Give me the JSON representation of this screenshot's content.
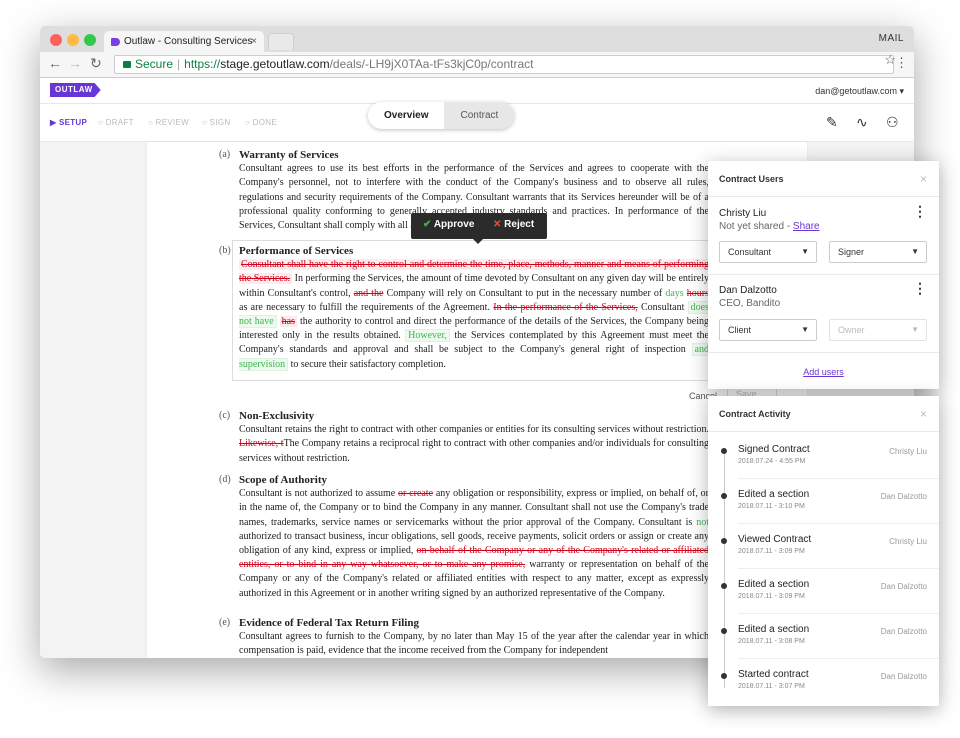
{
  "browser": {
    "tab_title": "Outlaw - Consulting Services",
    "tab_close": "×",
    "mail_label": "MAIL",
    "secure_label": "Secure",
    "url_scheme": "https://",
    "url_host": "stage.getoutlaw.com",
    "url_path": "/deals/-LH9jX0TAa-tFs3kjC0p/contract"
  },
  "app": {
    "logo": "OUTLAW",
    "user_email": "dan@getoutlaw.com ▾",
    "steps": [
      "▶ SETUP",
      "○ DRAFT",
      "○ REVIEW",
      "○ SIGN",
      "○ DONE"
    ],
    "view_tabs": [
      "Overview",
      "Contract"
    ]
  },
  "popover": {
    "approve": "Approve",
    "reject": "Reject",
    "approve_icon": "✔",
    "reject_icon": "✕"
  },
  "document": {
    "a": {
      "letter": "(a)",
      "title": "Warranty of Services",
      "body": "Consultant agrees to use its best efforts in the performance of the Services and agrees to cooperate with the Company's personnel, not to interfere with the conduct of the Company's business and to observe all rules, regulations and security requirements of the Company. Consultant warrants that its Services hereunder will be of a professional quality conforming to generally accepted industry standards and practices. In performance of the Services, Consultant shall comply with all applicable law."
    },
    "b": {
      "letter": "(b)",
      "title": "Performance of Services",
      "del1": "Consultant shall have the right to control and determine the time, place, methods, manner and means of performing the Services.",
      "t1": " In performing the Services, the amount of time devoted by Consultant on any given day will be entirely within Consultant's control, ",
      "del2": "and the",
      "t2": " Company will rely on Consultant to put in the necessary number of ",
      "ins1": "days",
      "del3": "hours",
      "t3": " as are necessary to fulfill the requirements of the Agreement. ",
      "del4": "In the performance of the Services,",
      "t4": " Consultant ",
      "ins2": "does not have",
      "del5": "has",
      "t5": " the authority to control and direct the performance of the details of the Services, the Company being interested only in the results obtained. ",
      "ins3": "However,",
      "t6": " the Services contemplated by this Agreement must meet the Company's standards and approval and shall be subject to the Company's general right of inspection ",
      "ins4": "and supervision",
      "t7": " to secure their satisfactory completion."
    },
    "cancel": "Cancel",
    "save": "Save",
    "c": {
      "letter": "(c)",
      "title": "Non-Exclusivity",
      "t1": "Consultant retains the right to contract with other companies or entities for its consulting services without restriction. ",
      "del1": "Likewise, t",
      "t2": "The Company retains a reciprocal right to contract with other companies and/or individuals for consulting services without restriction."
    },
    "d": {
      "letter": "(d)",
      "title": "Scope of Authority",
      "t1": "Consultant is not authorized to assume ",
      "del1": "or create",
      "t2": " any obligation or responsibility, express or implied, on behalf of, or in the name of, the Company or to bind the Company in any manner. Consultant shall not use the Company's trade names, trademarks, service names or servicemarks without the prior approval of the Company. Consultant is ",
      "ins1": "not",
      "t3": " authorized to transact business, incur obligations, sell goods, receive payments, solicit orders or assign or create any obligation of any kind, express or implied, ",
      "del2": "on behalf of the Company or any of the Company's related or affiliated entities, or to bind in any way whatsoever, or to make any promise,",
      "t4": " warranty or representation on behalf of the Company or any of the Company's related or affiliated entities with respect to any matter, except as expressly authorized in this Agreement or in another writing signed by an authorized representative of the Company."
    },
    "e": {
      "letter": "(e)",
      "title": "Evidence of Federal Tax Return Filing",
      "body": "Consultant agrees to furnish to the Company, by no later than May 15 of the year after the calendar year in which compensation is paid, evidence that the income received from the Company for independent"
    }
  },
  "contract_users": {
    "title": "Contract Users",
    "close": "×",
    "users": [
      {
        "name": "Christy Liu",
        "status": "Not yet shared - ",
        "share": "Share",
        "role": "Consultant",
        "type": "Signer",
        "type_disabled": false
      },
      {
        "name": "Dan Dalzotto",
        "status": "CEO, Bandito",
        "share": "",
        "role": "Client",
        "type": "Owner",
        "type_disabled": true
      }
    ],
    "add_users": "Add users"
  },
  "contract_activity": {
    "title": "Contract Activity",
    "close": "×",
    "items": [
      {
        "title": "Signed Contract",
        "time": "2018.07.24 - 4:55 PM",
        "user": "Christy Liu"
      },
      {
        "title": "Edited a section",
        "time": "2018.07.11 - 3:10 PM",
        "user": "Dan Dalzotto"
      },
      {
        "title": "Viewed Contract",
        "time": "2018.07.11 - 3:09 PM",
        "user": "Christy Liu"
      },
      {
        "title": "Edited a section",
        "time": "2018.07.11 - 3:09 PM",
        "user": "Dan Dalzotto"
      },
      {
        "title": "Edited a section",
        "time": "2018.07.11 - 3:08 PM",
        "user": "Dan Dalzotto"
      },
      {
        "title": "Started contract",
        "time": "2018.07.11 - 3:07 PM",
        "user": "Dan Dalzotto"
      }
    ]
  }
}
